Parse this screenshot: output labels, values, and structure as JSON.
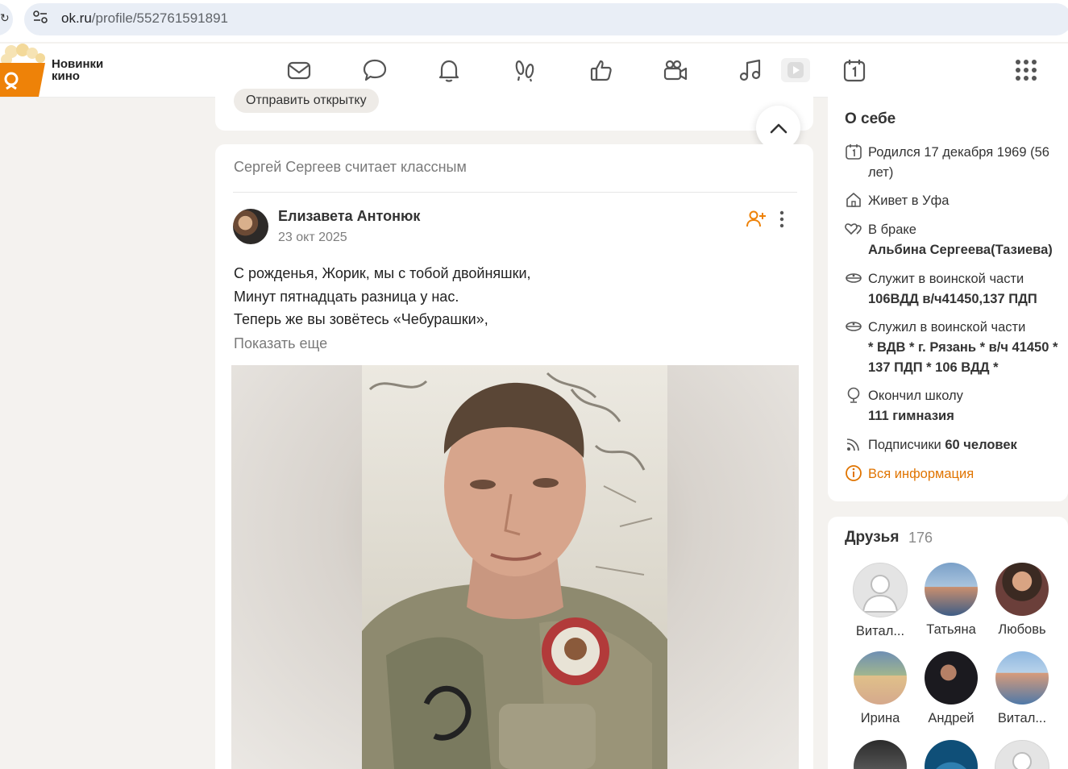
{
  "browser": {
    "url_host": "ok.ru",
    "url_path": "/profile/552761591891"
  },
  "header": {
    "promo_line1": "Новинки",
    "promo_line2": "кино",
    "nav_icons": [
      "mail-icon",
      "chat-bubble-icon",
      "bell-icon",
      "guests-footprints-icon",
      "like-thumb-icon",
      "video-camera-icon",
      "music-note-icon",
      "video-play-icon",
      "calendar-icon",
      "apps-grid-icon"
    ]
  },
  "top_card": {
    "postcard_button": "Отправить открытку"
  },
  "post": {
    "context": "Сергей Сергеев считает классным",
    "author": "Елизавета Антонюк",
    "date": "23 окт 2025",
    "lines": [
      "С рожденья, Жорик, мы с тобой двойняшки,",
      "Минут пятнадцать разница у нас.",
      "Теперь же вы зовётесь «Чебурашки»,"
    ],
    "show_more": "Показать еще"
  },
  "about": {
    "title": "О себе",
    "birth": "Родился 17 декабря 1969 (56 лет)",
    "lives": "Живет в Уфа",
    "married_label": "В браке",
    "married_name": "Альбина Сергеева(Тазиева)",
    "serves_label": "Служит в воинской части",
    "serves_value": "106ВДД в/ч41450,137 ПДП",
    "served_label": "Служил в воинской части",
    "served_value": "* ВДВ * г. Рязань * в/ч 41450 * 137 ПДП * 106 ВДД *",
    "school_label": "Окончил школу",
    "school_value": "111 гимназия",
    "subscribers_label": "Подписчики",
    "subscribers_value": "60 человек",
    "all_info": "Вся информация",
    "accent_color": "#e07400"
  },
  "friends": {
    "title": "Друзья",
    "count": "176",
    "items": [
      {
        "name": "Витал..."
      },
      {
        "name": "Татьяна"
      },
      {
        "name": "Любовь"
      },
      {
        "name": "Ирина"
      },
      {
        "name": "Андрей"
      },
      {
        "name": "Витал..."
      }
    ]
  }
}
